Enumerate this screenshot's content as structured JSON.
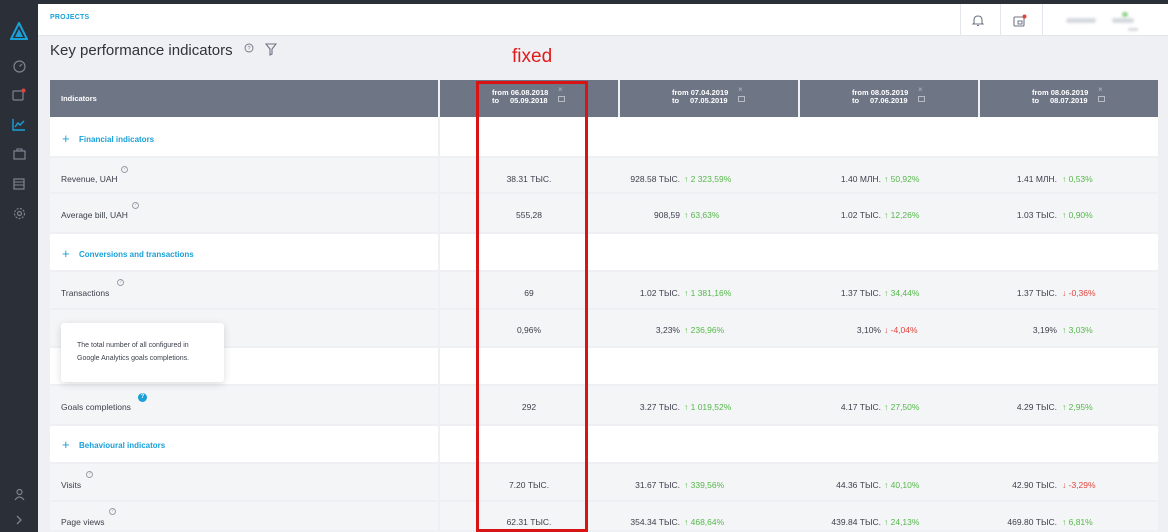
{
  "header": {
    "projects_link": "PROJECTS"
  },
  "page": {
    "title": "Key performance indicators",
    "fixed_annotation": "fixed"
  },
  "table": {
    "first_header": "Indicators",
    "columns": [
      {
        "from": "from 06.08.2018",
        "to_label": "to",
        "to_date": "05.09.2018"
      },
      {
        "from": "from 07.04.2019",
        "to_label": "to",
        "to_date": "07.05.2019"
      },
      {
        "from": "from 08.05.2019",
        "to_label": "to",
        "to_date": "07.06.2019"
      },
      {
        "from": "from 08.06.2019",
        "to_label": "to",
        "to_date": "08.07.2019"
      }
    ],
    "groups": {
      "financial": "Financial indicators",
      "conversions": "Conversions and transactions",
      "behavioural": "Behavioural indicators"
    },
    "rows": {
      "revenue": {
        "label": "Revenue, UAH",
        "c1": "38.31 ТЫС.",
        "c2": "928.58 ТЫС.",
        "c2ch": "↑ 2 323,59%",
        "c3": "1.40 МЛН.",
        "c3ch": "↑ 50,92%",
        "c4": "1.41 МЛН.",
        "c4ch": "↑ 0,53%"
      },
      "avgbill": {
        "label": "Average bill, UAH",
        "c1": "555,28",
        "c2": "908,59",
        "c2ch": "↑ 63,63%",
        "c3": "1.02 ТЫС.",
        "c3ch": "↑ 12,26%",
        "c4": "1.03 ТЫС.",
        "c4ch": "↑ 0,90%"
      },
      "transactions": {
        "label": "Transactions",
        "c1": "69",
        "c2": "1.02 ТЫС.",
        "c2ch": "↑ 1 381,16%",
        "c3": "1.37 ТЫС.",
        "c3ch": "↑ 34,44%",
        "c4": "1.37 ТЫС.",
        "c4ch": "↓ -0,36%"
      },
      "convrate": {
        "label": "",
        "c1": "0,96%",
        "c2": "3,23%",
        "c2ch": "↑ 236,96%",
        "c3": "3,10%",
        "c3ch": "↓ -4,04%",
        "c4": "3,19%",
        "c4ch": "↑ 3,03%"
      },
      "goals": {
        "label": "Goals completions",
        "c1": "292",
        "c2": "3.27 ТЫС.",
        "c2ch": "↑ 1 019,52%",
        "c3": "4.17 ТЫС.",
        "c3ch": "↑ 27,50%",
        "c4": "4.29 ТЫС.",
        "c4ch": "↑ 2,95%"
      },
      "visits": {
        "label": "Visits",
        "c1": "7.20 ТЫС.",
        "c2": "31.67 ТЫС.",
        "c2ch": "↑ 339,56%",
        "c3": "44.36 ТЫС.",
        "c3ch": "↑ 40,10%",
        "c4": "42.90 ТЫС.",
        "c4ch": "↓ -3,29%"
      },
      "pageviews": {
        "label": "Page views",
        "c1": "62.31 ТЫС.",
        "c2": "354.34 ТЫС.",
        "c2ch": "↑ 468,64%",
        "c3": "439.84 ТЫС.",
        "c3ch": "↑ 24,13%",
        "c4": "469.80 ТЫС.",
        "c4ch": "↑ 6,81%"
      }
    }
  },
  "tooltip": {
    "line1": "The total number of all configured in",
    "line2": "Google Analytics goals completions."
  },
  "colors": {
    "accent": "#1aa0d8",
    "up": "#55b84a",
    "down": "#e0443c",
    "header_bg": "#6e7584",
    "sidebar_bg": "#2b2f38",
    "highlight": "#d81414"
  }
}
